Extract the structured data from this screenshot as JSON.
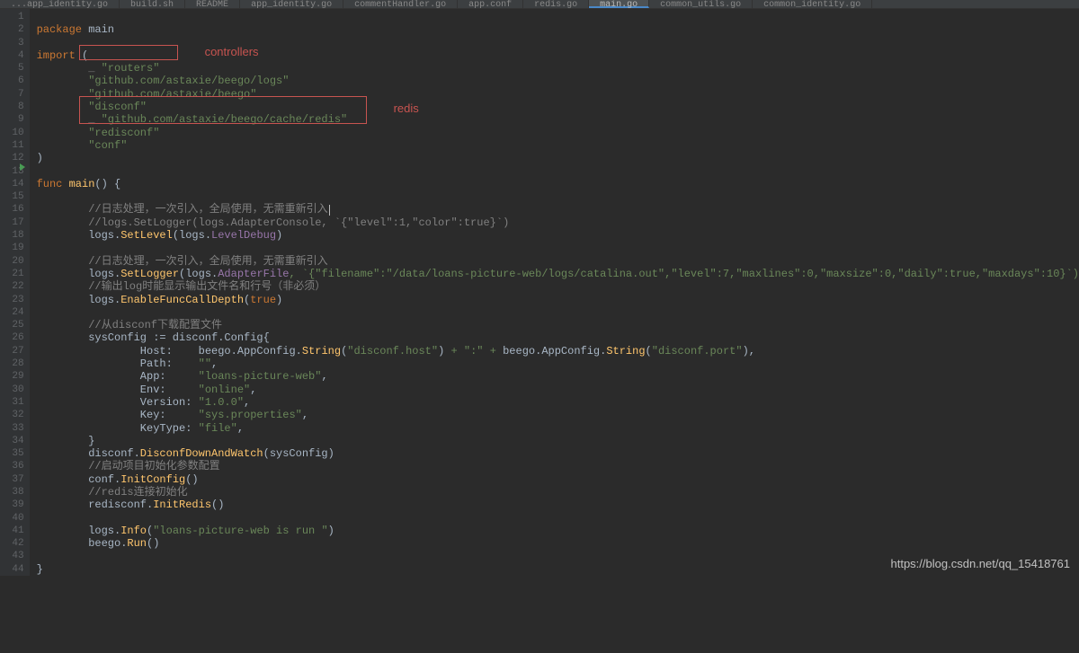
{
  "tabs": [
    {
      "label": "...app_identity.go",
      "active": false
    },
    {
      "label": "build.sh",
      "active": false
    },
    {
      "label": "README",
      "active": false
    },
    {
      "label": "app_identity.go",
      "active": false
    },
    {
      "label": "commentHandler.go",
      "active": false
    },
    {
      "label": "app.conf",
      "active": false
    },
    {
      "label": "redis.go",
      "active": false
    },
    {
      "label": "main.go",
      "active": true
    },
    {
      "label": "common_utils.go",
      "active": false
    },
    {
      "label": "common_identity.go",
      "active": false
    }
  ],
  "gutter": {
    "start": 1,
    "end": 44
  },
  "annotations": {
    "controllers": "controllers",
    "redis": "redis"
  },
  "code": {
    "l1": {
      "kw": "package",
      "name": "main"
    },
    "l3": {
      "kw": "import",
      "paren": "("
    },
    "l4": {
      "us": "_",
      "str": "\"routers\""
    },
    "l5": {
      "str": "\"github.com/astaxie/beego/logs\""
    },
    "l6": {
      "str": "\"github.com/astaxie/beego\""
    },
    "l7": {
      "str": "\"disconf\""
    },
    "l8": {
      "us": "_",
      "str": "\"github.com/astaxie/beego/cache/redis\""
    },
    "l9": {
      "str": "\"redisconf\""
    },
    "l10": {
      "str": "\"conf\""
    },
    "l11": {
      "paren": ")"
    },
    "l13": {
      "kw": "func",
      "name": "main",
      "sig": "() {"
    },
    "l15": {
      "cmt": "//日志处理，一次引入，全局使用，无需重新引入"
    },
    "l16": {
      "cmt": "//logs.SetLogger(logs.AdapterConsole, `{\"level\":1,\"color\":true}`)"
    },
    "l17": {
      "a": "logs.",
      "b": "SetLevel",
      "c": "(logs.",
      "d": "LevelDebug",
      "e": ")"
    },
    "l19": {
      "cmt": "//日志处理，一次引入，全局使用，无需重新引入"
    },
    "l20": {
      "a": "logs.",
      "b": "SetLogger",
      "c": "(logs.",
      "d": "AdapterFile",
      "e": ", `{\"filename\":\"/data/loans-picture-web/logs/catalina.out\",\"level\":7,\"maxlines\":0,\"maxsize\":0,\"daily\":true,\"maxdays\":10}`)"
    },
    "l21": {
      "cmt": "//输出log时能显示输出文件名和行号（非必须）"
    },
    "l22": {
      "a": "logs.",
      "b": "EnableFuncCallDepth",
      "c": "(",
      "d": "true",
      "e": ")"
    },
    "l24": {
      "cmt": "//从disconf下载配置文件"
    },
    "l25": {
      "a": "sysConfig := disconf.",
      "b": "Config",
      "c": "{"
    },
    "l26": {
      "k": "Host:",
      "v": "beego.AppConfig.",
      "m": "String",
      "s1": "\"disconf.host\"",
      "plus": " + \":\" + ",
      "v2": "beego.AppConfig.",
      "m2": "String",
      "s2": "\"disconf.port\""
    },
    "l27": {
      "k": "Path:",
      "s": "\"\""
    },
    "l28": {
      "k": "App:",
      "s": "\"loans-picture-web\""
    },
    "l29": {
      "k": "Env:",
      "s": "\"online\""
    },
    "l30": {
      "k": "Version:",
      "s": "\"1.0.0\""
    },
    "l31": {
      "k": "Key:",
      "s": "\"sys.properties\""
    },
    "l32": {
      "k": "KeyType:",
      "s": "\"file\""
    },
    "l33": {
      "brace": "}"
    },
    "l34": {
      "a": "disconf.",
      "b": "DisconfDownAndWatch",
      "c": "(sysConfig)"
    },
    "l35": {
      "cmt": "//启动项目初始化参数配置"
    },
    "l36": {
      "a": "conf.",
      "b": "InitConfig",
      "c": "()"
    },
    "l37": {
      "cmt": "//redis连接初始化"
    },
    "l38": {
      "a": "redisconf.",
      "b": "InitRedis",
      "c": "()"
    },
    "l40": {
      "a": "logs.",
      "b": "Info",
      "c": "(",
      "s": "\"loans-picture-web is run \"",
      "d": ")"
    },
    "l41": {
      "a": "beego.",
      "b": "Run",
      "c": "()"
    },
    "l43": {
      "brace": "}"
    }
  },
  "watermark": "https://blog.csdn.net/qq_15418761"
}
